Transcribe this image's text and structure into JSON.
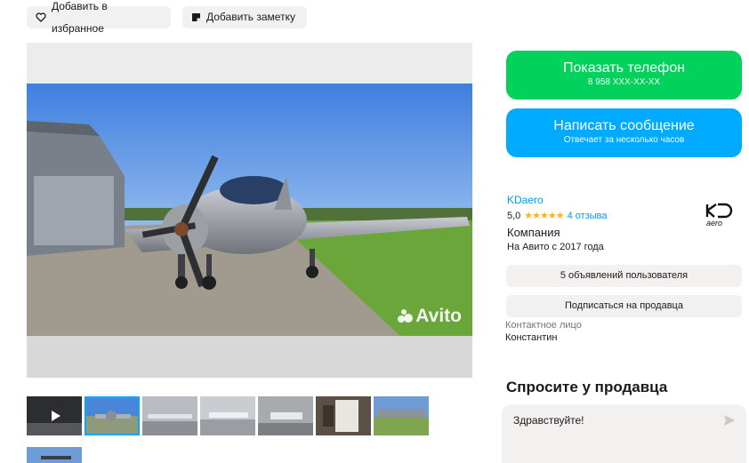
{
  "actions": {
    "favorite_label": "Добавить в избранное",
    "note_label": "Добавить заметку"
  },
  "gallery": {
    "watermark": "Avito",
    "thumbnail_count": 8,
    "active_thumbnail": 2
  },
  "contact_buttons": {
    "phone_label": "Показать телефон",
    "phone_number": "8 958 XXX-XX-XX",
    "message_label": "Написать сообщение",
    "message_sub": "Отвечает за несколько часов"
  },
  "seller": {
    "name": "KDaero",
    "rating": "5,0",
    "stars": "★★★★★",
    "reviews": "4 отзыва",
    "type": "Компания",
    "since": "На Авито с 2017 года",
    "logo_text": "aero",
    "ads_button": "5 объявлений пользователя",
    "subscribe_button": "Подписаться на продавца",
    "contact_label": "Контактное лицо",
    "contact_name": "Константин"
  },
  "ask": {
    "title": "Спросите у продавца",
    "message": "Здравствуйте!"
  },
  "colors": {
    "green": "#02d15c",
    "blue": "#00aaff",
    "link": "#0099f7",
    "star": "#ffb021"
  }
}
